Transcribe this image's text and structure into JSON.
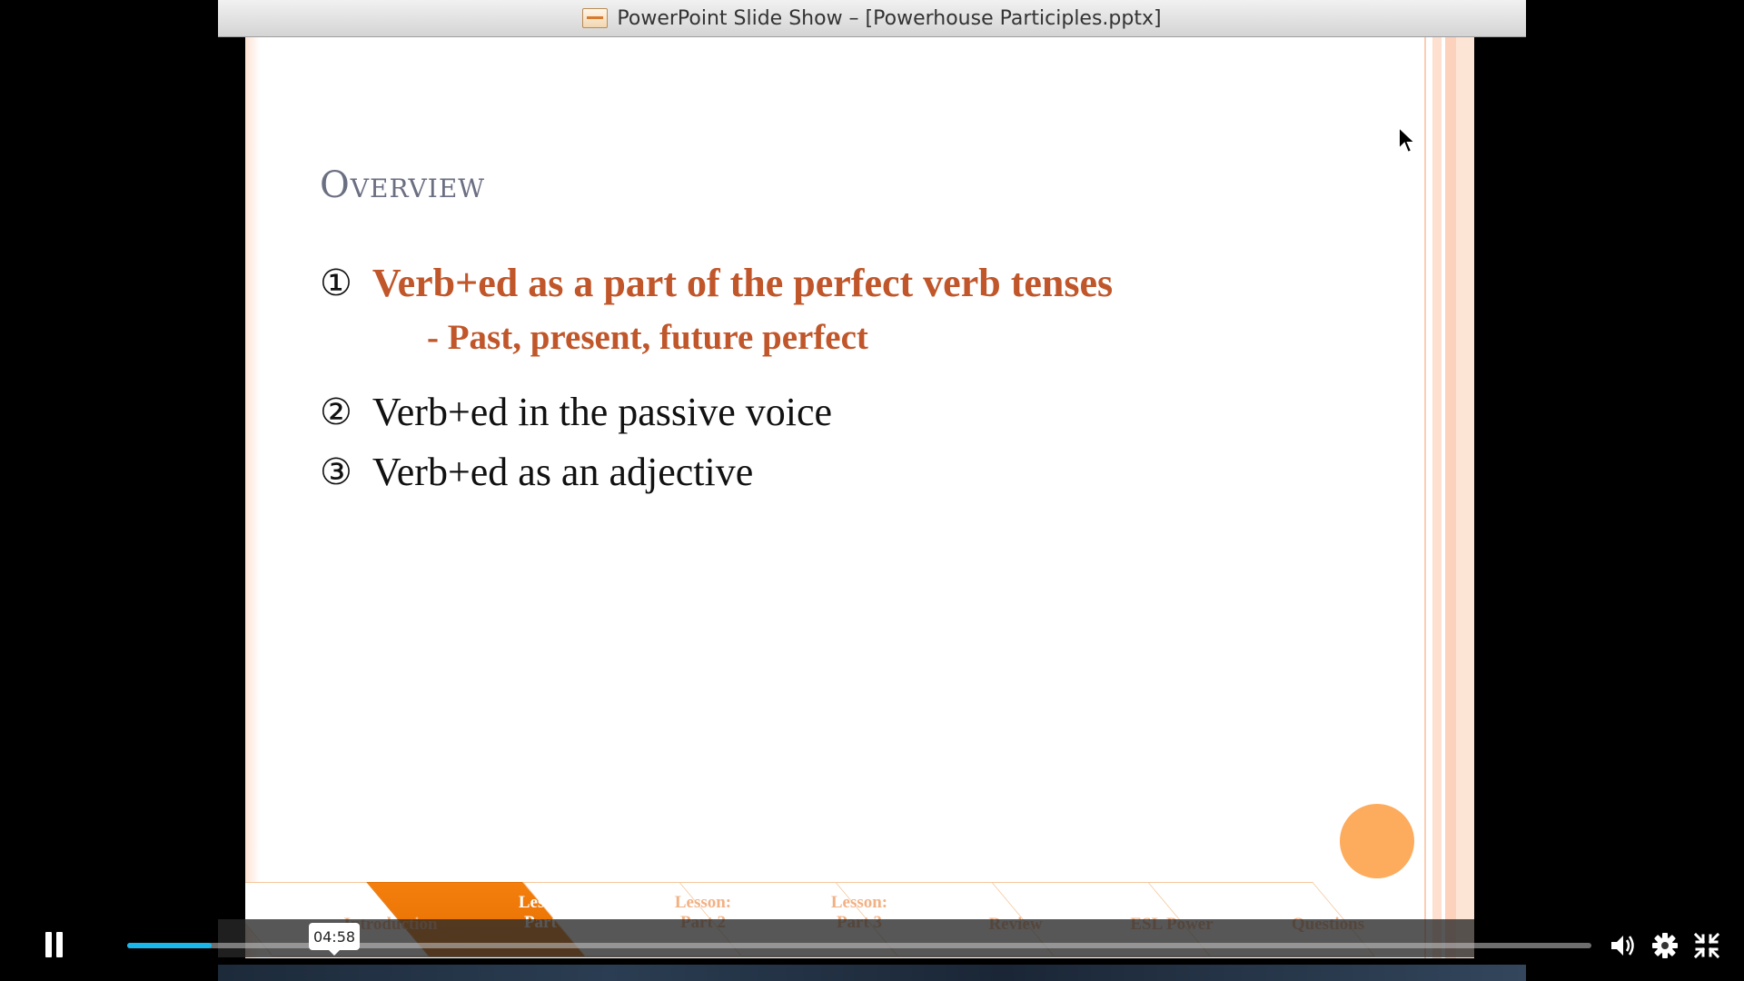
{
  "window": {
    "title": "PowerPoint Slide Show – [Powerhouse Participles.pptx]"
  },
  "slide": {
    "title": "Overview",
    "bullets": [
      {
        "num": "①",
        "text": "Verb+ed as a part of the perfect verb tenses"
      },
      {
        "num": "②",
        "text": "Verb+ed in the passive voice"
      },
      {
        "num": "③",
        "text": "Verb+ed as an adjective"
      }
    ],
    "sub_bullet": "- Past, present, future perfect",
    "nav_tabs": [
      {
        "label": "Introduction"
      },
      {
        "label": "Lesson:\nPart 1"
      },
      {
        "label": "Lesson:\nPart 2"
      },
      {
        "label": "Lesson:\nPart 3"
      },
      {
        "label": "Review"
      },
      {
        "label": "ESL Power"
      },
      {
        "label": "Questions"
      }
    ],
    "active_tab_index": 1,
    "colors": {
      "accent": "#c0562a",
      "tab_active": "#f57f0d",
      "circle": "#fdab5c"
    }
  },
  "player": {
    "time_tooltip": "04:58",
    "progress_fraction": 0.058,
    "accent": "#1ab7ea",
    "icons": [
      "pause-icon",
      "volume-icon",
      "settings-icon",
      "exit-fullscreen-icon"
    ]
  }
}
